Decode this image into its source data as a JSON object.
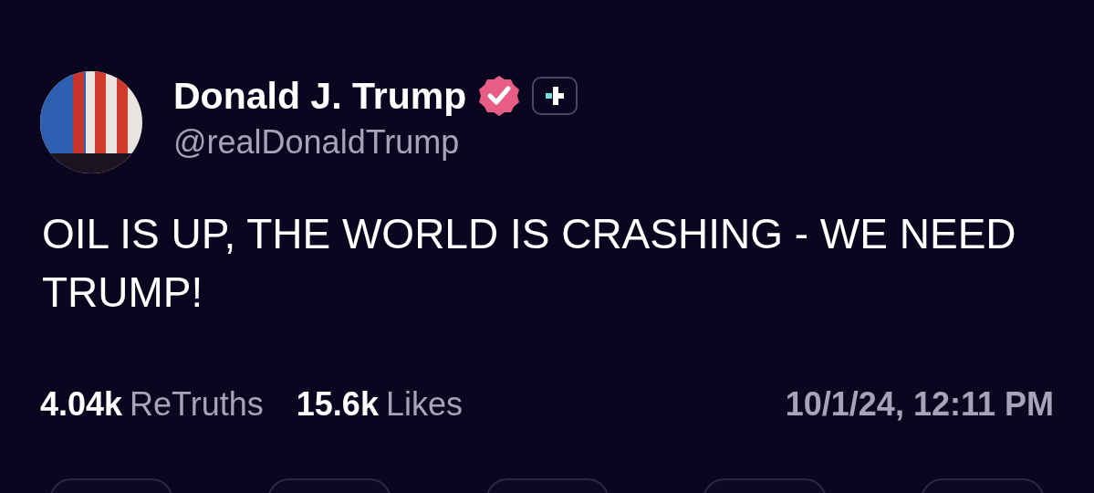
{
  "author": {
    "name": "Donald J. Trump",
    "handle": "@realDonaldTrump",
    "verified": true
  },
  "post": {
    "text": "OIL IS UP, THE WORLD IS CRASHING - WE NEED TRUMP!"
  },
  "stats": [
    {
      "count": "4.04k",
      "label": "ReTruths"
    },
    {
      "count": "15.6k",
      "label": "Likes"
    }
  ],
  "timestamp": "10/1/24, 12:11 PM"
}
